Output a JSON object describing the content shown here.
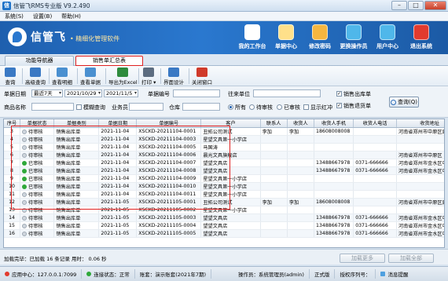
{
  "window": {
    "title": "信管飞RMS专业版 V9.2.490",
    "app_badge": "信"
  },
  "menu": [
    "系统(S)",
    "设置(B)",
    "帮助(H)"
  ],
  "brand": {
    "name": "信管飞",
    "slogan": "• 精细化管理软件"
  },
  "nav": [
    {
      "label": "我的工作台",
      "icon": "desk-icon",
      "color": "#ffffff"
    },
    {
      "label": "单据中心",
      "icon": "documents-icon",
      "color": "#ffe08a"
    },
    {
      "label": "修改密码",
      "icon": "key-icon",
      "color": "#f5b640"
    },
    {
      "label": "更换操作员",
      "icon": "users-icon",
      "color": "#4fb7ea"
    },
    {
      "label": "用户中心",
      "icon": "user-center-icon",
      "color": "#4fb7ea"
    },
    {
      "label": "退出系统",
      "icon": "power-icon",
      "color": "#e23b2e"
    }
  ],
  "tabs": {
    "nav": "功能导航器",
    "active": "销售单汇总表"
  },
  "toolbar": [
    {
      "label": "查询",
      "icon": "query-icon",
      "color": "#3a79c4"
    },
    {
      "label": "高级查询",
      "icon": "advanced-query-icon",
      "color": "#3a79c4"
    },
    {
      "label": "查看明细",
      "icon": "detail-icon",
      "color": "#4a90d0"
    },
    {
      "label": "查看单据",
      "icon": "view-document-icon",
      "color": "#4a90d0"
    },
    {
      "label": "导出为Excel",
      "icon": "excel-icon",
      "color": "#2e8b3d"
    },
    {
      "label": "打印 ▾",
      "icon": "print-icon",
      "color": "#5d6d80"
    },
    {
      "label": "界面设计",
      "icon": "layout-icon",
      "color": "#3a79c4"
    },
    {
      "label": "关闭窗口",
      "icon": "close-window-icon",
      "color": "#d03a2a"
    }
  ],
  "filter": {
    "doc_date_label": "单据日期",
    "range": "最近7天",
    "date_from": "2021/10/29",
    "date_to": "2021/11/5",
    "doc_no_label": "单据编号",
    "partner_label": "往来单位",
    "product_label": "商品名称",
    "fuzzy_label": "模糊查询",
    "staff_label": "业务员",
    "warehouse_label": "仓库",
    "status_options": [
      "所有",
      "待审核",
      "已审核"
    ],
    "show_red_label": "显示红冲",
    "check_sales_out": "销售出库单",
    "check_sales_return": "销售退货单",
    "query_button": "查询(Q)"
  },
  "grid": {
    "columns": [
      "序号",
      "单据状态",
      "单据类别",
      "单据日期",
      "单据编号",
      "客户",
      "联系人",
      "收货人",
      "收货人手机",
      "收货人电话",
      "收货地址",
      "发货方式"
    ],
    "rows": [
      {
        "no": "3",
        "status": "待审核",
        "done": false,
        "type": "销售出库单",
        "date": "2021-11-04",
        "code": "XSCKD-20211104-0001",
        "customer": "丑拓公司测试",
        "contact": "李加",
        "receiver": "李加",
        "mobile": "18608008008",
        "phone": "",
        "address": "河南省郑州市中原区建设",
        "ship": "第三方物"
      },
      {
        "no": "4",
        "status": "待审核",
        "done": false,
        "type": "销售出库单",
        "date": "2021-11-04",
        "code": "XSCKD-20211104-0003",
        "customer": "星望文具第一小学店",
        "contact": "",
        "receiver": "",
        "mobile": "",
        "phone": "",
        "address": "",
        "ship": ""
      },
      {
        "no": "5",
        "status": "待审核",
        "done": false,
        "type": "销售出库单",
        "date": "2021-11-04",
        "code": "XSCKD-20211104-0005",
        "customer": "马国涛",
        "contact": "",
        "receiver": "",
        "mobile": "",
        "phone": "",
        "address": "",
        "ship": ""
      },
      {
        "no": "6",
        "status": "待审核",
        "done": false,
        "type": "销售出库单",
        "date": "2021-11-04",
        "code": "XSCKD-20211104-0006",
        "customer": "晨光文具旗舰店",
        "contact": "",
        "receiver": "",
        "mobile": "",
        "phone": "",
        "address": "河南省郑州市中原区",
        "ship": ""
      },
      {
        "no": "7",
        "status": "已审核",
        "done": true,
        "type": "销售出库单",
        "date": "2021-11-04",
        "code": "XSCKD-20211104-0007",
        "customer": "望望文具店",
        "contact": "",
        "receiver": "",
        "mobile": "13488667978",
        "phone": "0371-666666",
        "address": "河南省郑州市金水区中原",
        "ship": "第三方物"
      },
      {
        "no": "8",
        "status": "已审核",
        "done": true,
        "type": "销售出库单",
        "date": "2021-11-04",
        "code": "XSCKD-20211104-0008",
        "customer": "望望文具店",
        "contact": "",
        "receiver": "",
        "mobile": "13488667978",
        "phone": "0371-666666",
        "address": "河南省郑州市金水区中原",
        "ship": "第三方物"
      },
      {
        "no": "9",
        "status": "已审核",
        "done": true,
        "type": "销售出库单",
        "date": "2021-11-04",
        "code": "XSCKD-20211104-0009",
        "customer": "星望文具第一小学店",
        "contact": "",
        "receiver": "",
        "mobile": "",
        "phone": "",
        "address": "",
        "ship": ""
      },
      {
        "no": "10",
        "status": "已审核",
        "done": true,
        "type": "销售出库单",
        "date": "2021-11-04",
        "code": "XSCKD-20211104-0010",
        "customer": "星望文具第一小学店",
        "contact": "",
        "receiver": "",
        "mobile": "",
        "phone": "",
        "address": "",
        "ship": ""
      },
      {
        "no": "11",
        "status": "待审核",
        "done": false,
        "type": "销售出库单",
        "date": "2021-11-04",
        "code": "XSCKD-20211104-0011",
        "customer": "星望文具第一小学店",
        "contact": "",
        "receiver": "",
        "mobile": "",
        "phone": "",
        "address": "",
        "ship": ""
      },
      {
        "no": "12",
        "status": "待审核",
        "done": false,
        "type": "销售出库单",
        "date": "2021-11-05",
        "code": "XSCKD-20211105-0001",
        "customer": "丑拓公司测试",
        "contact": "李加",
        "receiver": "李加",
        "mobile": "18608008008",
        "phone": "",
        "address": "河南省郑州市中原区建设",
        "ship": "第三方物"
      },
      {
        "no": "13",
        "status": "待审核",
        "done": false,
        "type": "销售出库单",
        "date": "2021-11-05",
        "code": "XSCKD-20211105-0002",
        "customer": "星望文具第一小学店",
        "contact": "",
        "receiver": "",
        "mobile": "",
        "phone": "",
        "address": "",
        "ship": ""
      },
      {
        "no": "14",
        "status": "待审核",
        "done": false,
        "type": "销售出库单",
        "date": "2021-11-05",
        "code": "XSCKD-20211105-0003",
        "customer": "望望文具店",
        "contact": "",
        "receiver": "",
        "mobile": "13488667978",
        "phone": "0371-666666",
        "address": "河南省郑州市金水区中原",
        "ship": "第三方物"
      },
      {
        "no": "15",
        "status": "待审核",
        "done": false,
        "type": "销售出库单",
        "date": "2021-11-05",
        "code": "XSCKD-20211105-0004",
        "customer": "望望文具店",
        "contact": "",
        "receiver": "",
        "mobile": "13488667978",
        "phone": "0371-666666",
        "address": "河南省郑州市金水区中原",
        "ship": "第三方物"
      },
      {
        "no": "16",
        "status": "待审核",
        "done": false,
        "type": "销售出库单",
        "date": "2021-11-05",
        "code": "XSCKD-20211105-0005",
        "customer": "望望文具店",
        "contact": "",
        "receiver": "",
        "mobile": "13488667978",
        "phone": "0371-666666",
        "address": "河南省郑州市金水区中原",
        "ship": "第三方物"
      }
    ]
  },
  "status_line": {
    "loaded": "加载完毕：已加载 16 条记录 用时： 0.06 秒",
    "load_more": "加载更多",
    "load_all": "加载全部"
  },
  "bottom": {
    "app_center": "应用中心：127.0.0.1:7099",
    "connection": "连接状态：正常",
    "account": "账套：演示账套(2021年7期)",
    "operator": "操作员：系统管理员(admin)",
    "version": "正式版",
    "auth": "授权序列号：",
    "news": "消息提醒"
  },
  "colors": {
    "accent": "#2a78cf",
    "highlight": "#e02020",
    "approved": "#2fa83a"
  }
}
